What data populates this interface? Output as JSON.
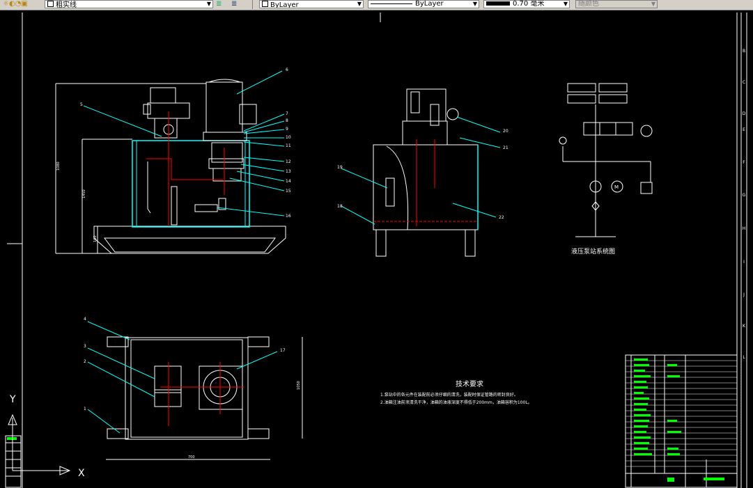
{
  "toolbar": {
    "linetype": "粗实线",
    "color": "ByLayer",
    "linetype2": "ByLayer",
    "lineweight": "0.70 毫米",
    "plotstyle": "随颜色"
  },
  "ucs": {
    "y": "Y",
    "x": "X"
  },
  "drawing": {
    "tech_title": "技术要求",
    "tech_line1": "1.泵站中的各元件在装配前必须仔细的清洗，装配时保证管路的密封良好。",
    "tech_line2": "2.油箱注油前须清洗干净，油箱的油液深度不得低于200mm，油箱容积为100L。",
    "schematic_title": "液压泵站系统图",
    "motor_label": "M",
    "front_callouts": [
      "6",
      "5",
      "7",
      "8",
      "9",
      "10",
      "11",
      "12",
      "13",
      "14",
      "15",
      "16"
    ],
    "side_callouts": [
      "20",
      "21",
      "19",
      "18",
      "22"
    ],
    "top_callouts": [
      "4",
      "3",
      "2",
      "1",
      "17"
    ],
    "dims": [
      "1080",
      "1450",
      "160",
      "700",
      "1050"
    ]
  },
  "border": {
    "zones": [
      "B",
      "C",
      "D",
      "E",
      "F",
      "G",
      "H",
      "I",
      "J",
      "K",
      "L"
    ]
  },
  "colors": {
    "white": "#ffffff",
    "cyan": "#00ffff",
    "red": "#ff0000",
    "green": "#00ff00",
    "accent": "#00ffff"
  }
}
